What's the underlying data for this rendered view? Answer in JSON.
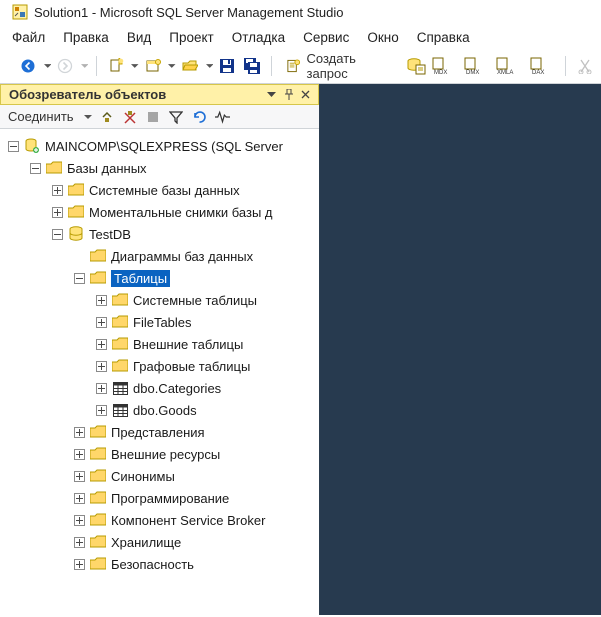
{
  "window": {
    "title": "Solution1 - Microsoft SQL Server Management Studio"
  },
  "menu": {
    "file": "Файл",
    "edit": "Правка",
    "view": "Вид",
    "project": "Проект",
    "debug": "Отладка",
    "service": "Сервис",
    "window": "Окно",
    "help": "Справка"
  },
  "toolbar": {
    "new_query": "Создать запрос",
    "mdx": "MDX",
    "dmx": "DMX",
    "xmla": "XMLA",
    "dax": "DAX"
  },
  "explorer": {
    "header": "Обозреватель объектов",
    "connect": "Соединить",
    "server": "MAINCOMP\\SQLEXPRESS (SQL Server",
    "root_databases": "Базы данных",
    "sys_db": "Системные базы данных",
    "snapshots": "Моментальные снимки базы д",
    "testdb": "TestDB",
    "diagrams": "Диаграммы баз данных",
    "tables": "Таблицы",
    "sys_tables": "Системные таблицы",
    "filetables": "FileTables",
    "ext_tables": "Внешние таблицы",
    "graph_tables": "Графовые таблицы",
    "dbo_categories": "dbo.Categories",
    "dbo_goods": "dbo.Goods",
    "views": "Представления",
    "ext_res": "Внешние ресурсы",
    "synonyms": "Синонимы",
    "programmability": "Программирование",
    "service_broker": "Компонент Service Broker",
    "storage": "Хранилище",
    "security": "Безопасность"
  }
}
